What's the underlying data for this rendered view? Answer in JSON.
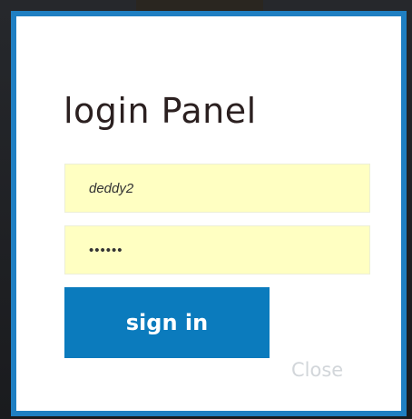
{
  "login_panel": {
    "title": "login Panel",
    "username": {
      "value": "deddy2"
    },
    "password": {
      "value": "••••••"
    },
    "signin_label": "sign in",
    "close_label": "Close"
  },
  "colors": {
    "frame_border": "#1f7fc2",
    "button_background": "#0b7bbd",
    "field_background": "#ffffc2",
    "title_text": "#2b2020",
    "close_text": "#d2d6da"
  }
}
